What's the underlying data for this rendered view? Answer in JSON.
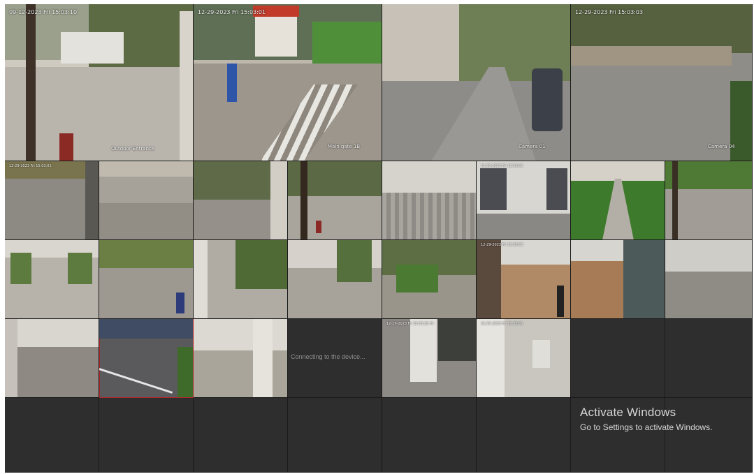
{
  "window": {
    "title": ""
  },
  "cameras": {
    "c1": {
      "timestamp": "09-12-2023 Fri 15:03:10",
      "caption": "Outdoor Entrance"
    },
    "c2": {
      "timestamp": "12-29-2023 Fri 15:03:01",
      "caption": "Main gate 1B"
    },
    "c3": {
      "timestamp": "",
      "caption": "Camera 01"
    },
    "c4": {
      "timestamp": "12-29-2023 Fri 15:03:03",
      "caption": "Camera 04"
    },
    "small": [
      {
        "timestamp": "12-29-2023 Fri 15:03:01"
      },
      {
        "timestamp": ""
      },
      {
        "timestamp": ""
      },
      {
        "timestamp": ""
      },
      {
        "timestamp": ""
      },
      {
        "timestamp": "12-29-2023 Fri 15:03:01"
      },
      {
        "timestamp": ""
      },
      {
        "timestamp": ""
      },
      {
        "timestamp": ""
      },
      {
        "timestamp": ""
      },
      {
        "timestamp": ""
      },
      {
        "timestamp": ""
      },
      {
        "timestamp": ""
      },
      {
        "timestamp": "12-29-2023 Fri 15:03:02"
      },
      {
        "timestamp": ""
      },
      {
        "timestamp": ""
      },
      {
        "timestamp": ""
      },
      {
        "timestamp": ""
      },
      {
        "timestamp": ""
      },
      {
        "timestamp": "12-29-2023 Fri 15:03:01 Fri"
      },
      {
        "timestamp": "12-29-2023 Fri 15:03:01"
      }
    ],
    "connecting_text": "Connecting to the device..."
  },
  "overlay": {
    "title": "Activate Windows",
    "subtitle": "Go to Settings to activate Windows."
  },
  "colors": {
    "empty_tile": "#2e2e2e",
    "selected_border": "#b3262b"
  }
}
